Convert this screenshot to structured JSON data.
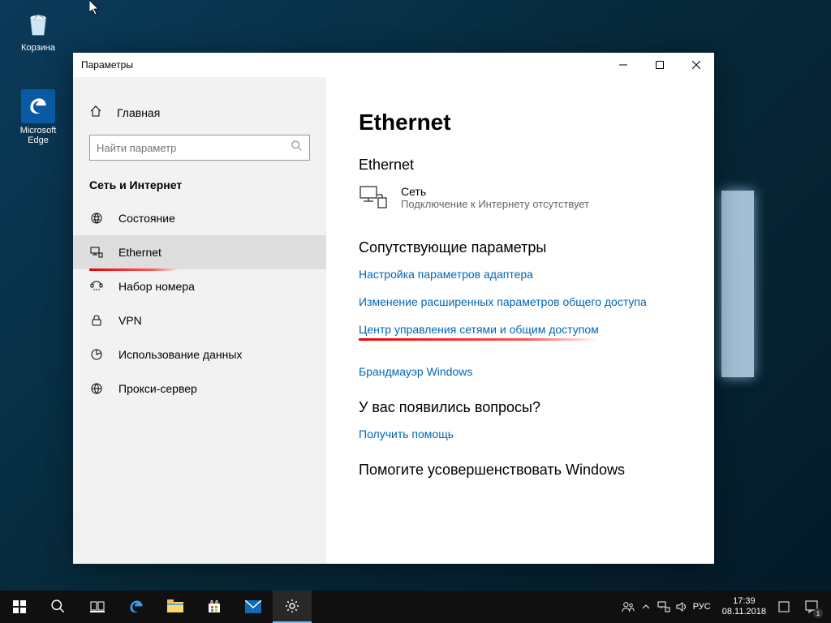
{
  "desktop": {
    "icons": [
      {
        "name": "recycle-bin",
        "label": "Корзина"
      },
      {
        "name": "edge",
        "label": "Microsoft Edge"
      }
    ]
  },
  "window": {
    "title": "Параметры",
    "home_label": "Главная",
    "search_placeholder": "Найти параметр",
    "section": "Сеть и Интернет",
    "nav": [
      {
        "id": "status",
        "label": "Состояние"
      },
      {
        "id": "ethernet",
        "label": "Ethernet",
        "active": true,
        "underlined": true
      },
      {
        "id": "dialup",
        "label": "Набор номера"
      },
      {
        "id": "vpn",
        "label": "VPN"
      },
      {
        "id": "data-usage",
        "label": "Использование данных"
      },
      {
        "id": "proxy",
        "label": "Прокси-сервер"
      }
    ]
  },
  "main": {
    "title": "Ethernet",
    "ethernet_heading": "Ethernet",
    "network_name": "Сеть",
    "network_status": "Подключение к Интернету отсутствует",
    "related_heading": "Сопутствующие параметры",
    "links": [
      {
        "label": "Настройка параметров адаптера"
      },
      {
        "label": "Изменение расширенных параметров общего доступа"
      },
      {
        "label": "Центр управления сетями и общим доступом",
        "underlined": true
      },
      {
        "label": "Брандмауэр Windows"
      }
    ],
    "questions_heading": "У вас появились вопросы?",
    "help_link": "Получить помощь",
    "feedback_heading": "Помогите усовершенствовать Windows"
  },
  "taskbar": {
    "lang": "РУС",
    "time": "17:39",
    "date": "08.11.2018",
    "notif_count": "1"
  }
}
